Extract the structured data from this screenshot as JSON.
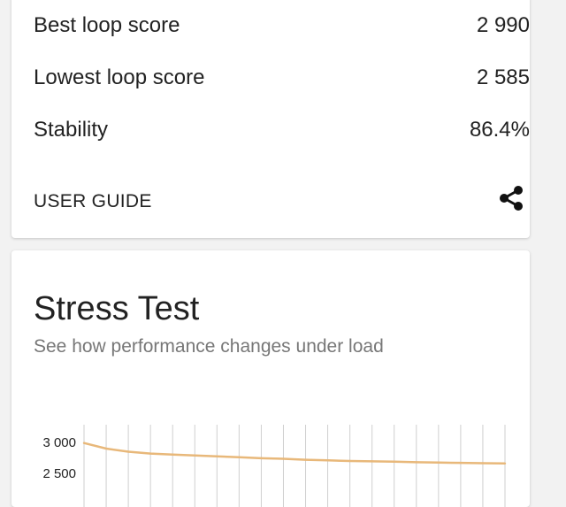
{
  "summary": {
    "rows": [
      {
        "label": "Best loop score",
        "value": "2 990"
      },
      {
        "label": "Lowest loop score",
        "value": "2 585"
      },
      {
        "label": "Stability",
        "value": "86.4%"
      }
    ],
    "user_guide_label": "USER GUIDE",
    "share_icon": "share-icon"
  },
  "stress_test": {
    "title": "Stress Test",
    "subtitle": "See how performance changes under load"
  },
  "chart_data": {
    "type": "line",
    "title": "",
    "xlabel": "",
    "ylabel": "",
    "y_tick_labels": [
      "3 000",
      "2 500"
    ],
    "y_ticks": [
      3000,
      2500
    ],
    "x": [
      1,
      2,
      3,
      4,
      5,
      6,
      7,
      8,
      9,
      10,
      11,
      12,
      13,
      14,
      15,
      16,
      17,
      18,
      19,
      20
    ],
    "series": [
      {
        "values": [
          2990,
          2900,
          2850,
          2820,
          2805,
          2790,
          2775,
          2760,
          2745,
          2735,
          2720,
          2710,
          2700,
          2695,
          2690,
          2680,
          2675,
          2670,
          2665,
          2660
        ]
      }
    ],
    "line_color": "#e8b87a",
    "grid": "vertical"
  }
}
